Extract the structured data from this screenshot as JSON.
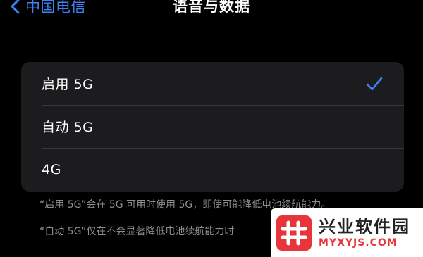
{
  "nav": {
    "back_label": "中国电信",
    "title": "语音与数据"
  },
  "options": [
    {
      "label": "启用 5G",
      "selected": true
    },
    {
      "label": "自动 5G",
      "selected": false
    },
    {
      "label": "4G",
      "selected": false
    }
  ],
  "notes": [
    "“启用 5G”会在 5G 可用时使用 5G，即使可能降低电池续航能力。",
    "“自动 5G”仅在不会显著降低电池续航能力时"
  ],
  "watermark": {
    "name": "兴业软件园",
    "url": "MYXYJS.COM"
  },
  "colors": {
    "accent": "#3a82f7",
    "background": "#000000",
    "group_background": "#1c1c1e",
    "note_text": "#8e8e93",
    "watermark_red": "#e8343b"
  },
  "icons": {
    "back": "chevron-left-icon",
    "selected": "checkmark-icon"
  }
}
